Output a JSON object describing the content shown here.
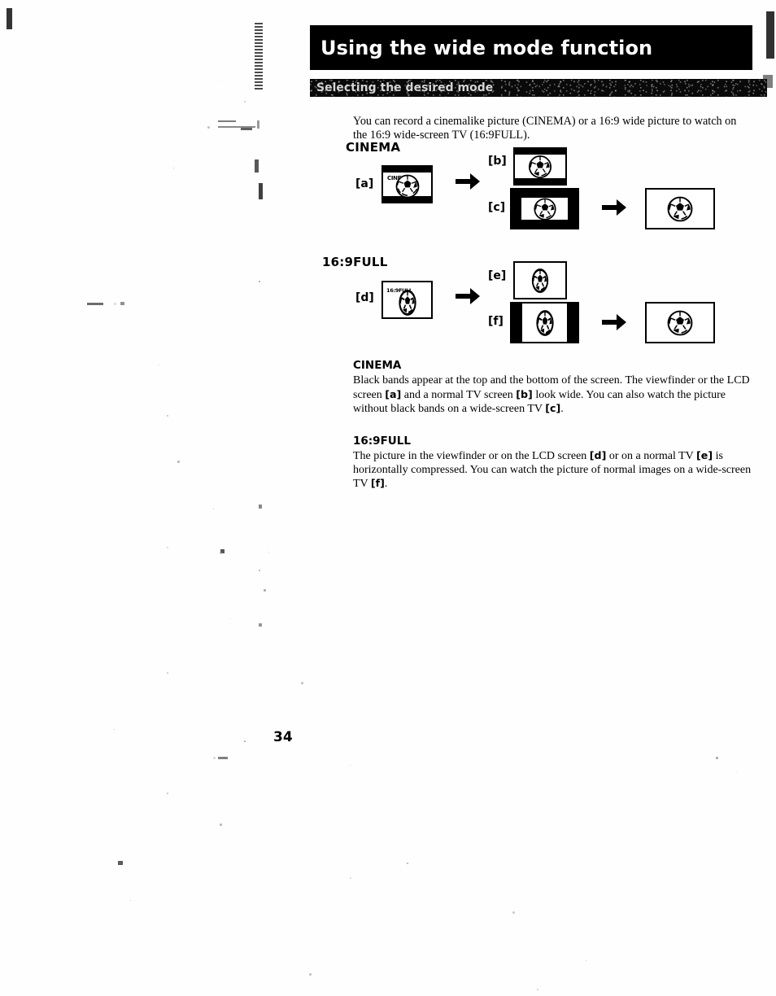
{
  "header": {
    "title": "Using the wide mode function",
    "subtitle": "Selecting the desired mode"
  },
  "intro": "You can record a cinemalike picture (CINEMA) or a 16:9 wide picture to watch on the 16:9 wide-screen TV (16:9FULL).",
  "diagrams": [
    {
      "label": "CINEMA",
      "viewfinder": {
        "tag": "[a]",
        "osd_label": "CINEMA"
      },
      "outputs": [
        {
          "tag": "[b]",
          "kind": "normal-tv-letterbox"
        },
        {
          "tag": "[c]",
          "kind": "wide-tv-bordered"
        }
      ],
      "final": {
        "kind": "wide-screen-tv"
      }
    },
    {
      "label": "16:9FULL",
      "viewfinder": {
        "tag": "[d]",
        "osd_label": "16:9FULL"
      },
      "outputs": [
        {
          "tag": "[e]",
          "kind": "normal-tv-compressed"
        },
        {
          "tag": "[f]",
          "kind": "wide-tv-pillarbox"
        }
      ],
      "final": {
        "kind": "wide-screen-tv"
      }
    }
  ],
  "descriptions": [
    {
      "heading": "CINEMA",
      "body_parts": [
        {
          "t": "Black bands appear at the top and the bottom of the screen.  The viewfinder or the LCD screen ",
          "b": false
        },
        {
          "t": "[a]",
          "b": true
        },
        {
          "t": " and a normal TV screen ",
          "b": false
        },
        {
          "t": "[b]",
          "b": true
        },
        {
          "t": " look wide.  You can also watch the picture without black bands on a wide-screen TV ",
          "b": false
        },
        {
          "t": "[c]",
          "b": true
        },
        {
          "t": ".",
          "b": false
        }
      ]
    },
    {
      "heading": "16:9FULL",
      "body_parts": [
        {
          "t": "The picture in the viewfinder or on the LCD screen ",
          "b": false
        },
        {
          "t": "[d]",
          "b": true
        },
        {
          "t": " or on a normal TV ",
          "b": false
        },
        {
          "t": "[e]",
          "b": true
        },
        {
          "t": " is horizontally compressed.  You can watch the picture of normal images on a wide-screen TV ",
          "b": false
        },
        {
          "t": "[f]",
          "b": true
        },
        {
          "t": ".",
          "b": false
        }
      ]
    }
  ],
  "footer": {
    "page_number": "34"
  },
  "colors": {
    "ink": "#000000",
    "paper": "#ffffff",
    "bar": "#000000"
  }
}
